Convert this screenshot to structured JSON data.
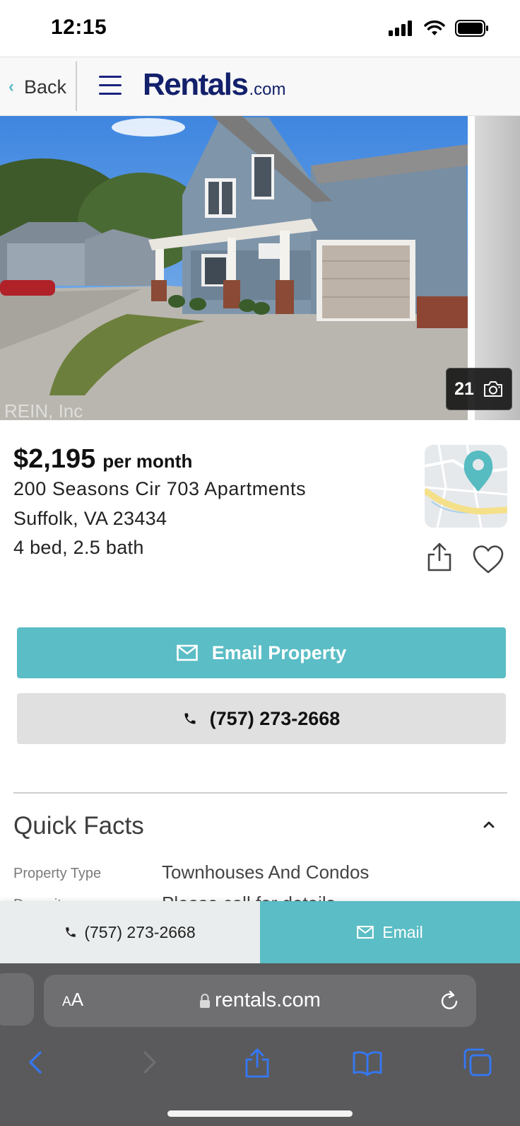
{
  "status_bar": {
    "time": "12:15"
  },
  "header": {
    "back_label": "Back",
    "logo_main": "Rentals",
    "logo_suffix": ".com"
  },
  "gallery": {
    "photo_count": "21"
  },
  "listing": {
    "price": "$2,195",
    "price_unit": "per month",
    "address_line1": "200 Seasons Cir 703 Apartments",
    "address_line2": "Suffolk, VA 23434",
    "beds_baths": "4 bed, 2.5 bath"
  },
  "actions": {
    "email_property_label": "Email Property",
    "phone_label": "(757) 273-2668"
  },
  "quick_facts": {
    "title": "Quick Facts",
    "rows": [
      {
        "label": "Property Type",
        "value": "Townhouses And Condos"
      },
      {
        "label": "Deposit",
        "value": "Please call for details"
      }
    ]
  },
  "sticky_bar": {
    "phone_label": "(757) 273-2668",
    "email_label": "Email"
  },
  "browser": {
    "aa_small": "A",
    "aa_large": "A",
    "url": "rentals.com"
  },
  "colors": {
    "accent": "#5bbdc5",
    "brand_navy": "#13206b",
    "browser_chrome": "#5a5a5c",
    "ios_blue": "#3478f6"
  }
}
